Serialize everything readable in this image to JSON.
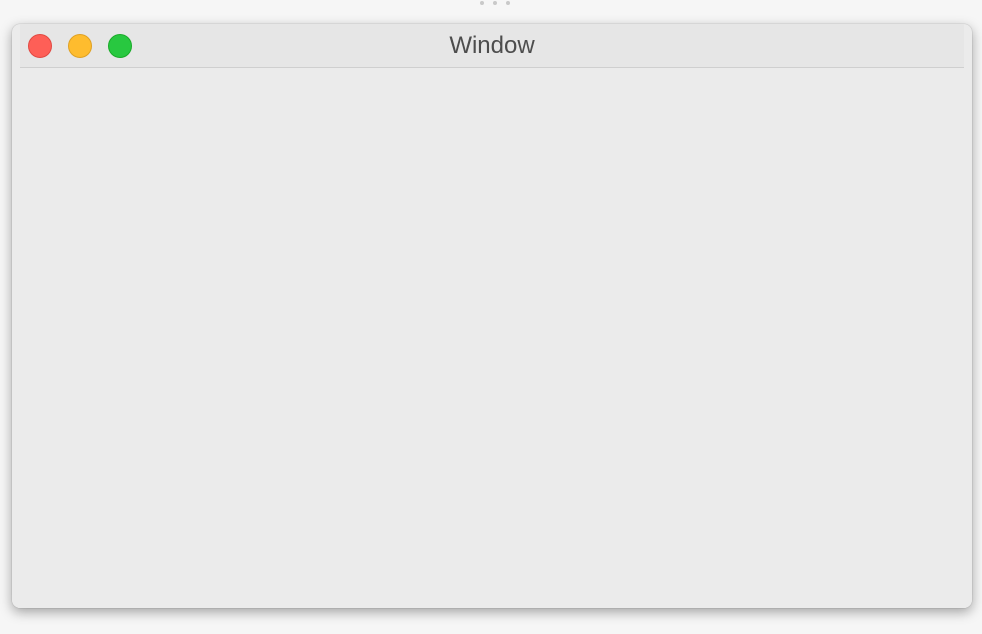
{
  "window": {
    "title": "Window",
    "controls": {
      "close_icon": "close-icon",
      "minimize_icon": "minimize-icon",
      "zoom_icon": "zoom-icon",
      "close_color": "#fe5f57",
      "minimize_color": "#febc2e",
      "zoom_color": "#28c840"
    }
  }
}
